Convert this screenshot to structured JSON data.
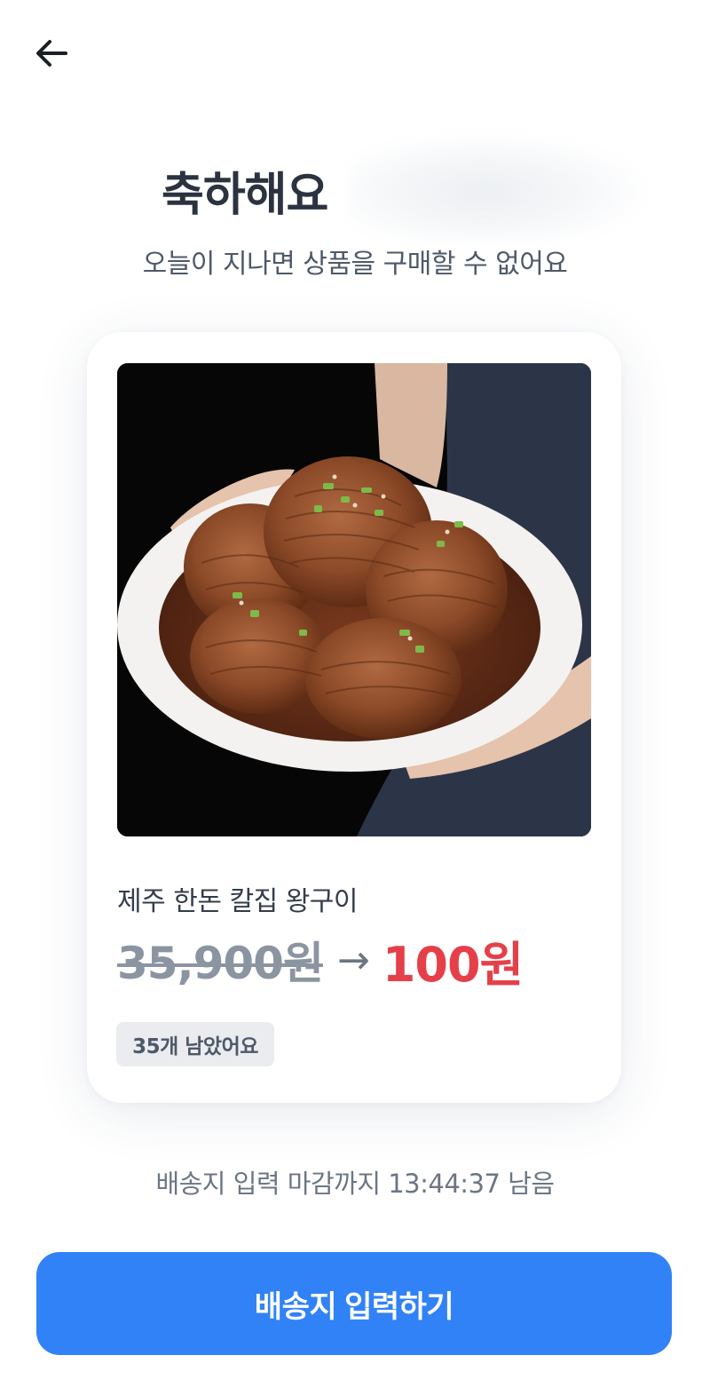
{
  "header": {
    "back_icon": "arrow-left-icon"
  },
  "title": "축하해요",
  "subtitle": "오늘이 지나면 상품을 구매할 수 없어요",
  "product": {
    "image_icon": "product-photo",
    "name": "제주 한돈 칼집 왕구이",
    "original_price": "35,900원",
    "arrow": "→",
    "sale_price": "100원",
    "stock_badge": "35개 남았어요"
  },
  "deadline_text": "배송지 입력 마감까지 13:44:37 남음",
  "cta_label": "배송지 입력하기",
  "colors": {
    "primary": "#3182f6",
    "sale_red": "#e5404a",
    "muted": "#8b95a1",
    "text": "#333d4b"
  }
}
